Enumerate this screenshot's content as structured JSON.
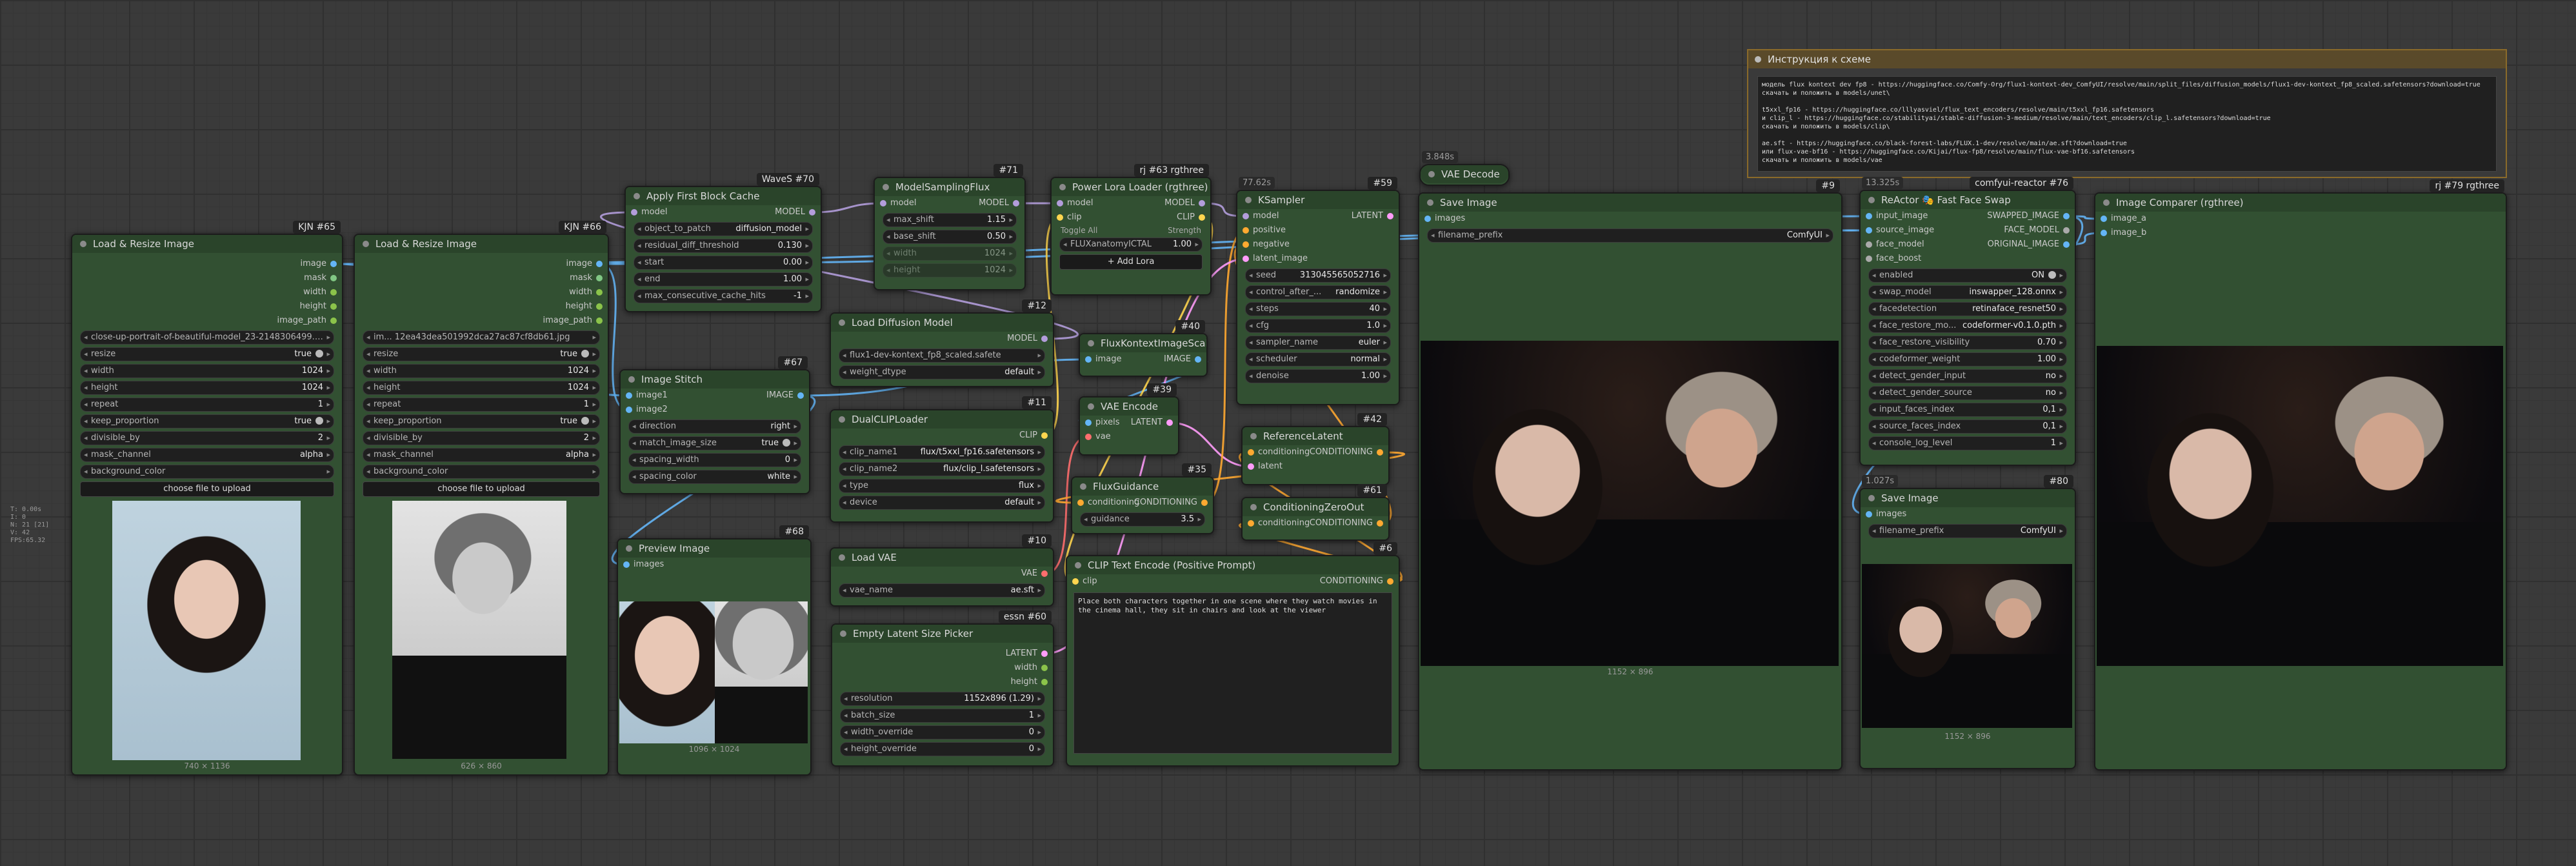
{
  "hud": [
    "T: 0.00s",
    "I: 0",
    "N: 21 [21]",
    "V: 42",
    "FPS:65.32"
  ],
  "wire_colors": {
    "image": "#64b5f6",
    "model": "#b39ddb",
    "clip": "#ffd54f",
    "conditioning": "#ffa931",
    "latent": "#ff9cf9",
    "vae": "#ff6e6e",
    "int": "#8bc34a",
    "face": "#aaaaaa"
  },
  "nodes": {
    "lr1": {
      "badge": "KJN #65",
      "title": "Load & Resize Image",
      "outputs": [
        "image",
        "mask",
        "width",
        "height",
        "image_path"
      ],
      "widgets": [
        {
          "k": "close-up-portrait-of-beautiful-model_23-2148306499.jpg",
          "v": ""
        },
        {
          "k": "resize",
          "v": "true"
        },
        {
          "k": "width",
          "v": "1024"
        },
        {
          "k": "height",
          "v": "1024"
        },
        {
          "k": "repeat",
          "v": "1"
        },
        {
          "k": "keep_proportion",
          "v": "true"
        },
        {
          "k": "divisible_by",
          "v": "2"
        },
        {
          "k": "mask_channel",
          "v": "alpha"
        },
        {
          "k": "background_color",
          "v": ""
        }
      ],
      "button": "choose file to upload",
      "caption": "740 × 1136"
    },
    "lr2": {
      "badge": "KJN #66",
      "title": "Load & Resize Image",
      "outputs": [
        "image",
        "mask",
        "width",
        "height",
        "image_path"
      ],
      "widgets": [
        {
          "k": "im... 12ea43dea501992dca27ac87cf8db61.jpg",
          "v": ""
        },
        {
          "k": "resize",
          "v": "true"
        },
        {
          "k": "width",
          "v": "1024"
        },
        {
          "k": "height",
          "v": "1024"
        },
        {
          "k": "repeat",
          "v": "1"
        },
        {
          "k": "keep_proportion",
          "v": "true"
        },
        {
          "k": "divisible_by",
          "v": "2"
        },
        {
          "k": "mask_channel",
          "v": "alpha"
        },
        {
          "k": "background_color",
          "v": ""
        }
      ],
      "button": "choose file to upload",
      "caption": "626 × 860"
    },
    "fbc": {
      "badge": "WaveS #70",
      "title": "Apply First Block Cache",
      "in": [
        "model"
      ],
      "out": [
        "MODEL"
      ],
      "widgets": [
        {
          "k": "object_to_patch",
          "v": "diffusion_model"
        },
        {
          "k": "residual_diff_threshold",
          "v": "0.130"
        },
        {
          "k": "start",
          "v": "0.00"
        },
        {
          "k": "end",
          "v": "1.00"
        },
        {
          "k": "max_consecutive_cache_hits",
          "v": "-1"
        }
      ]
    },
    "msf": {
      "badge": "#71",
      "title": "ModelSamplingFlux",
      "in": [
        "model"
      ],
      "out": [
        "MODEL"
      ],
      "widgets": [
        {
          "k": "max_shift",
          "v": "1.15"
        },
        {
          "k": "base_shift",
          "v": "0.50"
        },
        {
          "k": "width",
          "v": "1024"
        },
        {
          "k": "height",
          "v": "1024"
        }
      ]
    },
    "plora": {
      "badge": "rj #63 rgthree",
      "title": "Power Lora Loader (rgthree)",
      "in": [
        "model",
        "clip"
      ],
      "out": [
        "MODEL",
        "CLIP"
      ],
      "toggle_all": "Toggle All",
      "strength_label": "Strength",
      "lora_name": "FLUXanatomyICTAL",
      "lora_strength": "1.00",
      "add_button": "+ Add Lora"
    },
    "ksamp": {
      "badge": "#59",
      "badge2": "77.62s",
      "title": "KSampler",
      "in": [
        "model",
        "positive",
        "negative",
        "latent_image"
      ],
      "out": [
        "LATENT"
      ],
      "widgets": [
        {
          "k": "seed",
          "v": "313045565052716"
        },
        {
          "k": "control_after_...",
          "v": "randomize"
        },
        {
          "k": "steps",
          "v": "40"
        },
        {
          "k": "cfg",
          "v": "1.0"
        },
        {
          "k": "sampler_name",
          "v": "euler"
        },
        {
          "k": "scheduler",
          "v": "normal"
        },
        {
          "k": "denoise",
          "v": "1.00"
        }
      ]
    },
    "vaed": {
      "badge2": "3.848s",
      "title": "VAE Decode"
    },
    "save1": {
      "badge": "#9",
      "title": "Save Image",
      "in": [
        "images"
      ],
      "widgets": [
        {
          "k": "filename_prefix",
          "v": "ComfyUI"
        }
      ],
      "caption": "1152 × 896"
    },
    "stitch": {
      "badge": "#67",
      "title": "Image Stitch",
      "in": [
        "image1",
        "image2"
      ],
      "out": [
        "IMAGE"
      ],
      "widgets": [
        {
          "k": "direction",
          "v": "right"
        },
        {
          "k": "match_image_size",
          "v": "true"
        },
        {
          "k": "spacing_width",
          "v": "0"
        },
        {
          "k": "spacing_color",
          "v": "white"
        }
      ]
    },
    "preview": {
      "badge": "#68",
      "title": "Preview Image",
      "in": [
        "images"
      ],
      "caption": "1096 × 1024"
    },
    "ldm": {
      "badge": "#12",
      "title": "Load Diffusion Model",
      "out": [
        "MODEL"
      ],
      "widgets": [
        {
          "k": "flux1-dev-kontext_fp8_scaled.safete",
          "v": ""
        },
        {
          "k": "weight_dtype",
          "v": "default"
        }
      ]
    },
    "fkis": {
      "badge": "#40",
      "title": "FluxKontextImageScale",
      "in": [
        "image"
      ],
      "out": [
        "IMAGE"
      ]
    },
    "dclip": {
      "badge": "#11",
      "title": "DualCLIPLoader",
      "out": [
        "CLIP"
      ],
      "widgets": [
        {
          "k": "clip_name1",
          "v": "flux/t5xxl_fp16.safetensors"
        },
        {
          "k": "clip_name2",
          "v": "flux/clip_l.safetensors"
        },
        {
          "k": "type",
          "v": "flux"
        },
        {
          "k": "device",
          "v": "default"
        }
      ]
    },
    "vaee": {
      "badge": "#39",
      "title": "VAE Encode",
      "in": [
        "pixels",
        "vae"
      ],
      "out": [
        "LATENT"
      ]
    },
    "reflat": {
      "badge": "#42",
      "title": "ReferenceLatent",
      "in": [
        "conditioning",
        "latent"
      ],
      "out": [
        "CONDITIONING"
      ]
    },
    "fguid": {
      "badge": "#35",
      "title": "FluxGuidance",
      "in": [
        "conditioning"
      ],
      "out": [
        "CONDITIONING"
      ],
      "widgets": [
        {
          "k": "guidance",
          "v": "3.5"
        }
      ]
    },
    "czo": {
      "badge": "#61",
      "title": "ConditioningZeroOut",
      "in": [
        "conditioning"
      ],
      "out": [
        "CONDITIONING"
      ]
    },
    "lvae": {
      "badge": "#10",
      "title": "Load VAE",
      "out": [
        "VAE"
      ],
      "widgets": [
        {
          "k": "vae_name",
          "v": "ae.sft"
        }
      ]
    },
    "clipte": {
      "badge": "#6",
      "title": "CLIP Text Encode (Positive Prompt)",
      "in": [
        "clip"
      ],
      "out": [
        "CONDITIONING"
      ],
      "text": "Place both characters together in one scene where they watch movies in the cinema hall, they sit in chairs and look at the viewer"
    },
    "elsp": {
      "badge": "essn #60",
      "title": "Empty Latent Size Picker",
      "out": [
        "LATENT",
        "width",
        "height"
      ],
      "widgets": [
        {
          "k": "resolution",
          "v": "1152x896 (1.29)"
        },
        {
          "k": "batch_size",
          "v": "1"
        },
        {
          "k": "width_override",
          "v": "0"
        },
        {
          "k": "height_override",
          "v": "0"
        }
      ]
    },
    "instr": {
      "title": "Инструкция к схеме",
      "text": "модель flux kontext dev fp8 - https://huggingface.co/Comfy-Org/flux1-kontext-dev_ComfyUI/resolve/main/split_files/diffusion_models/flux1-dev-kontext_fp8_scaled.safetensors?download=true\nскачать и положить в models/unet\\\n\nt5xxl_fp16 - https://huggingface.co/lllyasviel/flux_text_encoders/resolve/main/t5xxl_fp16.safetensors\nи clip_l - https://huggingface.co/stabilityai/stable-diffusion-3-medium/resolve/main/text_encoders/clip_l.safetensors?download=true\nскачать и положить в models/clip\\\n\nae.sft - https://huggingface.co/black-forest-labs/FLUX.1-dev/resolve/main/ae.sft?download=true\nили flux-vae-bf16 - https://huggingface.co/Kijai/flux-fp8/resolve/main/flux-vae-bf16.safetensors\nскачать и положить в models/vae"
    },
    "react": {
      "badge": "comfyui-reactor #76",
      "badge2": "13.325s",
      "title": "ReActor 🎭 Fast Face Swap",
      "in": [
        "input_image",
        "source_image",
        "face_model",
        "face_boost"
      ],
      "out": [
        "SWAPPED_IMAGE",
        "FACE_MODEL",
        "ORIGINAL_IMAGE"
      ],
      "widgets": [
        {
          "k": "enabled",
          "v": "ON"
        },
        {
          "k": "swap_model",
          "v": "inswapper_128.onnx"
        },
        {
          "k": "facedetection",
          "v": "retinaface_resnet50"
        },
        {
          "k": "face_restore_mo...",
          "v": "codeformer-v0.1.0.pth"
        },
        {
          "k": "face_restore_visibility",
          "v": "0.70"
        },
        {
          "k": "codeformer_weight",
          "v": "1.00"
        },
        {
          "k": "detect_gender_input",
          "v": "no"
        },
        {
          "k": "detect_gender_source",
          "v": "no"
        },
        {
          "k": "input_faces_index",
          "v": "0,1"
        },
        {
          "k": "source_faces_index",
          "v": "0,1"
        },
        {
          "k": "console_log_level",
          "v": "1"
        }
      ]
    },
    "save2": {
      "badge": "#80",
      "badge2": "1.027s",
      "title": "Save Image",
      "in": [
        "images"
      ],
      "widgets": [
        {
          "k": "filename_prefix",
          "v": "ComfyUI"
        }
      ],
      "caption": "1152 × 896"
    },
    "cmp": {
      "badge": "rj #79 rgthree",
      "title": "Image Comparer (rgthree)",
      "in": [
        "image_a",
        "image_b"
      ]
    }
  }
}
